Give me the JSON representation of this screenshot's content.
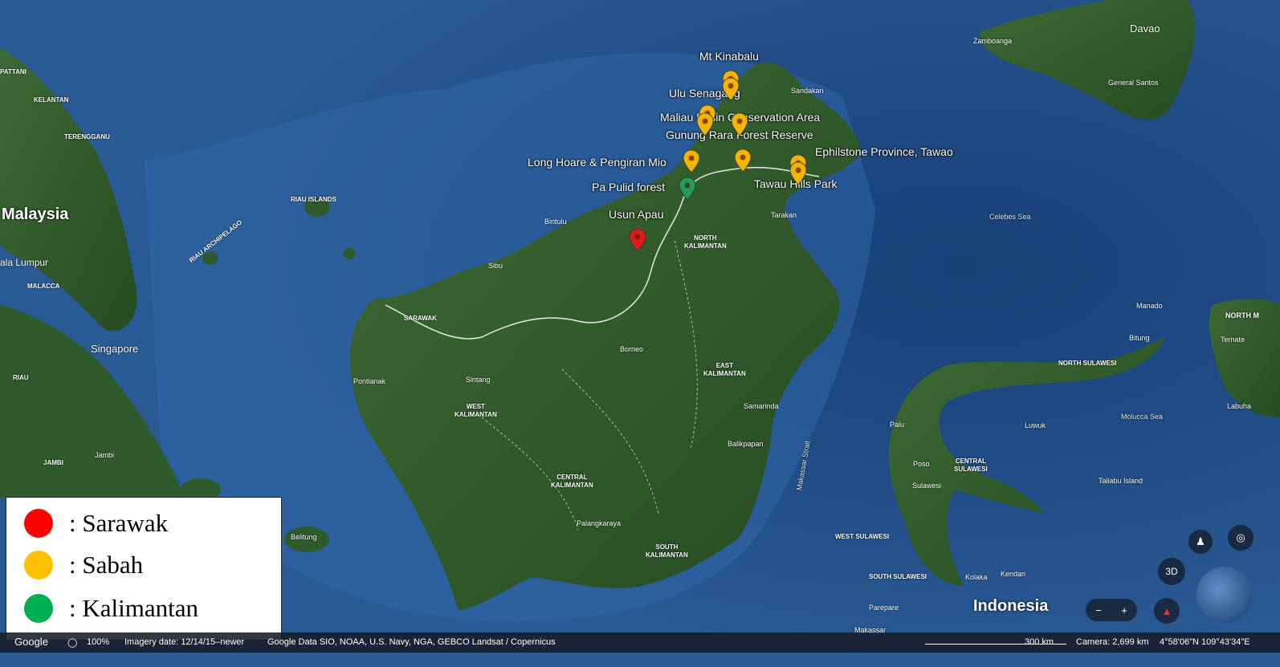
{
  "sites": [
    {
      "label": "Mt Kinabalu",
      "state": "Sabah"
    },
    {
      "label": "Ulu Senagang",
      "state": "Sabah"
    },
    {
      "label": "Maliau Basin Conservation Area",
      "state": "Sabah"
    },
    {
      "label": "Gunung Rara Forest Reserve",
      "state": "Sabah"
    },
    {
      "label": "Ephilstone Province, Tawao",
      "state": "Sabah"
    },
    {
      "label": "Long Hoare & Pengiran Mio",
      "state": "Sabah"
    },
    {
      "label": "Tawau Hills Park",
      "state": "Sabah"
    },
    {
      "label": "Pa Pulid forest",
      "state": "Kalimantan"
    },
    {
      "label": "Usun Apau",
      "state": "Sarawak"
    }
  ],
  "regions": {
    "north_kalimantan": "NORTH\nKALIMANTAN",
    "east_kalimantan": "EAST\nKALIMANTAN",
    "west_kalimantan": "WEST\nKALIMANTAN",
    "central_kalimantan": "CENTRAL\nKALIMANTAN",
    "south_kalimantan": "SOUTH\nKALIMANTAN",
    "sarawak": "SARAWAK",
    "north_sulawesi": "NORTH SULAWESI",
    "central_sulawesi": "CENTRAL\nSULAWESI",
    "west_sulawesi": "WEST SULAWESI",
    "south_sulawesi": "SOUTH SULAWESI",
    "riau_islands": "RIAU ISLANDS",
    "riau_archipelago": "RIAU ARCHIPELAGO",
    "kelantan": "KELANTAN",
    "terengganu": "TERENGGANU",
    "malacca": "MALACCA",
    "riau": "RIAU",
    "jambi": "JAMBI",
    "pattani": "PATTANI"
  },
  "places": {
    "malaysia": "Malaysia",
    "indonesia": "Indonesia",
    "singapore": "Singapore",
    "kuala_lumpur": "ala Lumpur",
    "borneo": "Borneo",
    "bintulu": "Bintulu",
    "sibu": "Sibu",
    "pontianak": "Pontianak",
    "sintang": "Sintang",
    "samarinda": "Samarinda",
    "balikpapan": "Balikpapan",
    "palangkaraya": "Palangkaraya",
    "belitung": "Belitung",
    "jambi_city": "Jambi",
    "tarakan": "Tarakan",
    "sandakan": "Sandakan",
    "zamboanga": "Zamboanga",
    "davao": "Davao",
    "general_santos": "General Santos",
    "manado": "Manado",
    "bitung": "Bitung",
    "ternate": "Ternate",
    "labuha": "Labuha",
    "palu": "Palu",
    "poso": "Poso",
    "luwuk": "Luwuk",
    "sulawesi_town": "Sulawesi",
    "taliabu": "Taliabu Island",
    "kolaka": "Kolaka",
    "kendari": "Kendari",
    "parepare": "Parepare",
    "makassar": "Makassar",
    "north_m": "NORTH M"
  },
  "seas": {
    "celebes": "Celebes Sea",
    "molucca": "Molucca Sea",
    "makassar_strait": "Makassar Strait"
  },
  "legend": {
    "items": [
      {
        "label": ": Sarawak",
        "color": "#ff0000"
      },
      {
        "label": ": Sabah",
        "color": "#ffc000"
      },
      {
        "label": ": Kalimantan",
        "color": "#00b050"
      }
    ]
  },
  "bottom_bar": {
    "google": "Google",
    "zoom": "100%",
    "imagery": "Imagery date: 12/14/15–newer",
    "data": "Google  Data SIO, NOAA, U.S. Navy, NGA, GEBCO  Landsat / Copernicus",
    "scale": "300 km",
    "camera": "Camera: 2,699 km",
    "coords": "4°58'06\"N 109°43'34\"E"
  },
  "controls": {
    "three_d": "3D",
    "zoom_out": "−",
    "zoom_in": "+"
  },
  "pin_colors": {
    "Sarawak": "#e01b1b",
    "Sabah": "#f4b400",
    "Kalimantan": "#1e9e56"
  }
}
